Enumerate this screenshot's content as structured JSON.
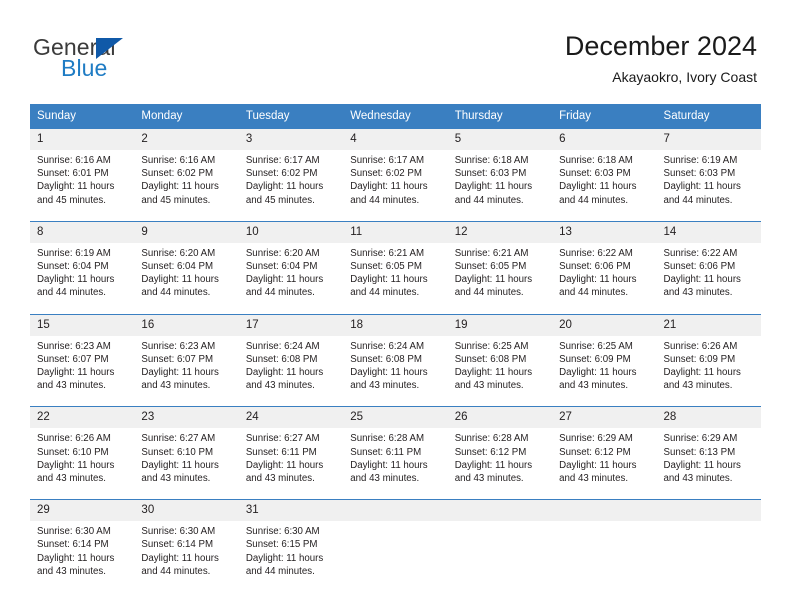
{
  "brand": {
    "name_part1": "General",
    "name_part2": "Blue",
    "colors": {
      "general": "#3b3b3b",
      "blue": "#1f7cc4",
      "triangle": "#1059a8"
    }
  },
  "header": {
    "title": "December 2024",
    "subtitle": "Akayaokro, Ivory Coast"
  },
  "theme": {
    "header_row_bg": "#3a7fc1",
    "header_row_text": "#ffffff",
    "daynum_bg": "#f0f0f0",
    "cell_border": "#3a7fc1",
    "body_text": "#231f20",
    "page_bg": "#ffffff"
  },
  "calendar": {
    "weekday_headers": [
      "Sunday",
      "Monday",
      "Tuesday",
      "Wednesday",
      "Thursday",
      "Friday",
      "Saturday"
    ],
    "weeks": [
      [
        {
          "day": "1",
          "sunrise": "Sunrise: 6:16 AM",
          "sunset": "Sunset: 6:01 PM",
          "daylight_line1": "Daylight: 11 hours",
          "daylight_line2": "and 45 minutes."
        },
        {
          "day": "2",
          "sunrise": "Sunrise: 6:16 AM",
          "sunset": "Sunset: 6:02 PM",
          "daylight_line1": "Daylight: 11 hours",
          "daylight_line2": "and 45 minutes."
        },
        {
          "day": "3",
          "sunrise": "Sunrise: 6:17 AM",
          "sunset": "Sunset: 6:02 PM",
          "daylight_line1": "Daylight: 11 hours",
          "daylight_line2": "and 45 minutes."
        },
        {
          "day": "4",
          "sunrise": "Sunrise: 6:17 AM",
          "sunset": "Sunset: 6:02 PM",
          "daylight_line1": "Daylight: 11 hours",
          "daylight_line2": "and 44 minutes."
        },
        {
          "day": "5",
          "sunrise": "Sunrise: 6:18 AM",
          "sunset": "Sunset: 6:03 PM",
          "daylight_line1": "Daylight: 11 hours",
          "daylight_line2": "and 44 minutes."
        },
        {
          "day": "6",
          "sunrise": "Sunrise: 6:18 AM",
          "sunset": "Sunset: 6:03 PM",
          "daylight_line1": "Daylight: 11 hours",
          "daylight_line2": "and 44 minutes."
        },
        {
          "day": "7",
          "sunrise": "Sunrise: 6:19 AM",
          "sunset": "Sunset: 6:03 PM",
          "daylight_line1": "Daylight: 11 hours",
          "daylight_line2": "and 44 minutes."
        }
      ],
      [
        {
          "day": "8",
          "sunrise": "Sunrise: 6:19 AM",
          "sunset": "Sunset: 6:04 PM",
          "daylight_line1": "Daylight: 11 hours",
          "daylight_line2": "and 44 minutes."
        },
        {
          "day": "9",
          "sunrise": "Sunrise: 6:20 AM",
          "sunset": "Sunset: 6:04 PM",
          "daylight_line1": "Daylight: 11 hours",
          "daylight_line2": "and 44 minutes."
        },
        {
          "day": "10",
          "sunrise": "Sunrise: 6:20 AM",
          "sunset": "Sunset: 6:04 PM",
          "daylight_line1": "Daylight: 11 hours",
          "daylight_line2": "and 44 minutes."
        },
        {
          "day": "11",
          "sunrise": "Sunrise: 6:21 AM",
          "sunset": "Sunset: 6:05 PM",
          "daylight_line1": "Daylight: 11 hours",
          "daylight_line2": "and 44 minutes."
        },
        {
          "day": "12",
          "sunrise": "Sunrise: 6:21 AM",
          "sunset": "Sunset: 6:05 PM",
          "daylight_line1": "Daylight: 11 hours",
          "daylight_line2": "and 44 minutes."
        },
        {
          "day": "13",
          "sunrise": "Sunrise: 6:22 AM",
          "sunset": "Sunset: 6:06 PM",
          "daylight_line1": "Daylight: 11 hours",
          "daylight_line2": "and 44 minutes."
        },
        {
          "day": "14",
          "sunrise": "Sunrise: 6:22 AM",
          "sunset": "Sunset: 6:06 PM",
          "daylight_line1": "Daylight: 11 hours",
          "daylight_line2": "and 43 minutes."
        }
      ],
      [
        {
          "day": "15",
          "sunrise": "Sunrise: 6:23 AM",
          "sunset": "Sunset: 6:07 PM",
          "daylight_line1": "Daylight: 11 hours",
          "daylight_line2": "and 43 minutes."
        },
        {
          "day": "16",
          "sunrise": "Sunrise: 6:23 AM",
          "sunset": "Sunset: 6:07 PM",
          "daylight_line1": "Daylight: 11 hours",
          "daylight_line2": "and 43 minutes."
        },
        {
          "day": "17",
          "sunrise": "Sunrise: 6:24 AM",
          "sunset": "Sunset: 6:08 PM",
          "daylight_line1": "Daylight: 11 hours",
          "daylight_line2": "and 43 minutes."
        },
        {
          "day": "18",
          "sunrise": "Sunrise: 6:24 AM",
          "sunset": "Sunset: 6:08 PM",
          "daylight_line1": "Daylight: 11 hours",
          "daylight_line2": "and 43 minutes."
        },
        {
          "day": "19",
          "sunrise": "Sunrise: 6:25 AM",
          "sunset": "Sunset: 6:08 PM",
          "daylight_line1": "Daylight: 11 hours",
          "daylight_line2": "and 43 minutes."
        },
        {
          "day": "20",
          "sunrise": "Sunrise: 6:25 AM",
          "sunset": "Sunset: 6:09 PM",
          "daylight_line1": "Daylight: 11 hours",
          "daylight_line2": "and 43 minutes."
        },
        {
          "day": "21",
          "sunrise": "Sunrise: 6:26 AM",
          "sunset": "Sunset: 6:09 PM",
          "daylight_line1": "Daylight: 11 hours",
          "daylight_line2": "and 43 minutes."
        }
      ],
      [
        {
          "day": "22",
          "sunrise": "Sunrise: 6:26 AM",
          "sunset": "Sunset: 6:10 PM",
          "daylight_line1": "Daylight: 11 hours",
          "daylight_line2": "and 43 minutes."
        },
        {
          "day": "23",
          "sunrise": "Sunrise: 6:27 AM",
          "sunset": "Sunset: 6:10 PM",
          "daylight_line1": "Daylight: 11 hours",
          "daylight_line2": "and 43 minutes."
        },
        {
          "day": "24",
          "sunrise": "Sunrise: 6:27 AM",
          "sunset": "Sunset: 6:11 PM",
          "daylight_line1": "Daylight: 11 hours",
          "daylight_line2": "and 43 minutes."
        },
        {
          "day": "25",
          "sunrise": "Sunrise: 6:28 AM",
          "sunset": "Sunset: 6:11 PM",
          "daylight_line1": "Daylight: 11 hours",
          "daylight_line2": "and 43 minutes."
        },
        {
          "day": "26",
          "sunrise": "Sunrise: 6:28 AM",
          "sunset": "Sunset: 6:12 PM",
          "daylight_line1": "Daylight: 11 hours",
          "daylight_line2": "and 43 minutes."
        },
        {
          "day": "27",
          "sunrise": "Sunrise: 6:29 AM",
          "sunset": "Sunset: 6:12 PM",
          "daylight_line1": "Daylight: 11 hours",
          "daylight_line2": "and 43 minutes."
        },
        {
          "day": "28",
          "sunrise": "Sunrise: 6:29 AM",
          "sunset": "Sunset: 6:13 PM",
          "daylight_line1": "Daylight: 11 hours",
          "daylight_line2": "and 43 minutes."
        }
      ],
      [
        {
          "day": "29",
          "sunrise": "Sunrise: 6:30 AM",
          "sunset": "Sunset: 6:14 PM",
          "daylight_line1": "Daylight: 11 hours",
          "daylight_line2": "and 43 minutes."
        },
        {
          "day": "30",
          "sunrise": "Sunrise: 6:30 AM",
          "sunset": "Sunset: 6:14 PM",
          "daylight_line1": "Daylight: 11 hours",
          "daylight_line2": "and 44 minutes."
        },
        {
          "day": "31",
          "sunrise": "Sunrise: 6:30 AM",
          "sunset": "Sunset: 6:15 PM",
          "daylight_line1": "Daylight: 11 hours",
          "daylight_line2": "and 44 minutes."
        },
        {
          "day": "",
          "sunrise": "",
          "sunset": "",
          "daylight_line1": "",
          "daylight_line2": ""
        },
        {
          "day": "",
          "sunrise": "",
          "sunset": "",
          "daylight_line1": "",
          "daylight_line2": ""
        },
        {
          "day": "",
          "sunrise": "",
          "sunset": "",
          "daylight_line1": "",
          "daylight_line2": ""
        },
        {
          "day": "",
          "sunrise": "",
          "sunset": "",
          "daylight_line1": "",
          "daylight_line2": ""
        }
      ]
    ]
  }
}
